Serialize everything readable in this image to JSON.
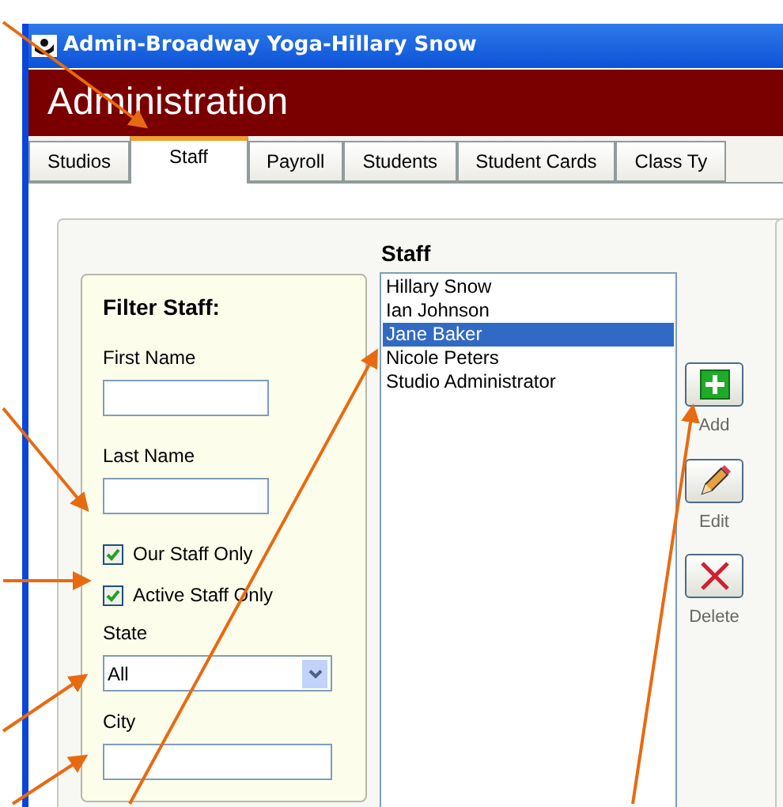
{
  "window": {
    "title": "Admin-Broadway Yoga-Hillary Snow"
  },
  "header": {
    "title": "Administration"
  },
  "tabs": [
    {
      "label": "Studios",
      "selected": false
    },
    {
      "label": "Staff",
      "selected": true
    },
    {
      "label": "Payroll",
      "selected": false
    },
    {
      "label": "Students",
      "selected": false
    },
    {
      "label": "Student Cards",
      "selected": false
    },
    {
      "label": "Class Ty",
      "selected": false
    }
  ],
  "filter": {
    "title": "Filter Staff:",
    "fields": [
      {
        "kind": "text",
        "label": "First Name"
      },
      {
        "kind": "text",
        "label": "Last Name"
      },
      {
        "kind": "checkbox",
        "label": "Our Staff Only",
        "checked": true
      },
      {
        "kind": "checkbox",
        "label": "Active Staff Only",
        "checked": true
      },
      {
        "kind": "dropdown",
        "label": "State",
        "value": "All"
      },
      {
        "kind": "text",
        "label": "City"
      }
    ]
  },
  "staff": {
    "title": "Staff",
    "items": [
      {
        "label": "Hillary Snow",
        "selected": false
      },
      {
        "label": "Ian Johnson",
        "selected": false
      },
      {
        "label": "Jane Baker",
        "selected": true
      },
      {
        "label": "Nicole Peters",
        "selected": false
      },
      {
        "label": "Studio Administrator",
        "selected": false
      }
    ]
  },
  "actions": [
    {
      "kind": "add",
      "label": "Add"
    },
    {
      "kind": "edit",
      "label": "Edit"
    },
    {
      "kind": "delete",
      "label": "Delete"
    }
  ]
}
